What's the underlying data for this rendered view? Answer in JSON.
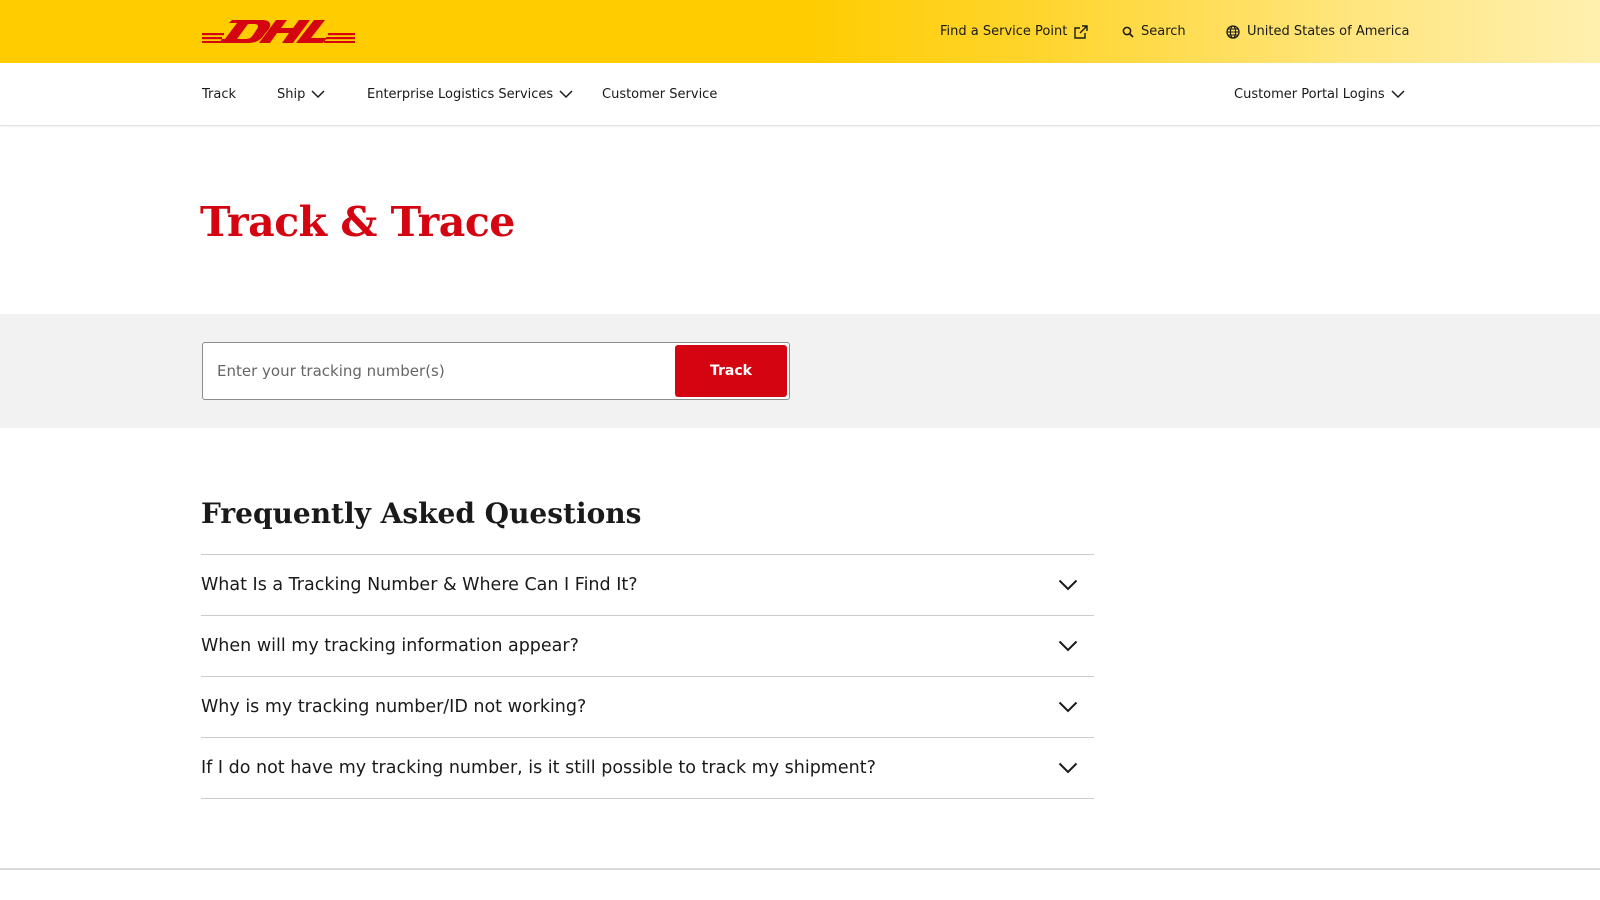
{
  "brand": {
    "logo_text": "DHL",
    "logo_color": "#d40511",
    "primary_yellow": "#ffcc00",
    "accent_red": "#d40511"
  },
  "topbar": {
    "find_service_point": "Find a Service Point",
    "find_service_point_icon": "external-link-icon",
    "search_label": "Search",
    "search_icon": "search-icon",
    "country_label": "United States of America",
    "country_icon": "globe-icon"
  },
  "nav": {
    "items": [
      {
        "label": "Track",
        "has_dropdown": false
      },
      {
        "label": "Ship",
        "has_dropdown": true
      },
      {
        "label": "Enterprise Logistics Services",
        "has_dropdown": true
      },
      {
        "label": "Customer Service",
        "has_dropdown": false
      }
    ],
    "portal_logins": {
      "label": "Customer Portal Logins",
      "has_dropdown": true
    }
  },
  "hero": {
    "title": "Track & Trace"
  },
  "tracking": {
    "input_placeholder": "Enter your tracking number(s)",
    "input_value": "",
    "button_label": "Track"
  },
  "faq": {
    "title": "Frequently Asked Questions",
    "items": [
      {
        "question": "What Is a Tracking Number & Where Can I Find It?",
        "expanded": false
      },
      {
        "question": "When will my tracking information appear?",
        "expanded": false
      },
      {
        "question": "Why is my tracking number/ID not working?",
        "expanded": false
      },
      {
        "question": "If I do not have my tracking number, is it still possible to track my shipment?",
        "expanded": false
      }
    ]
  }
}
